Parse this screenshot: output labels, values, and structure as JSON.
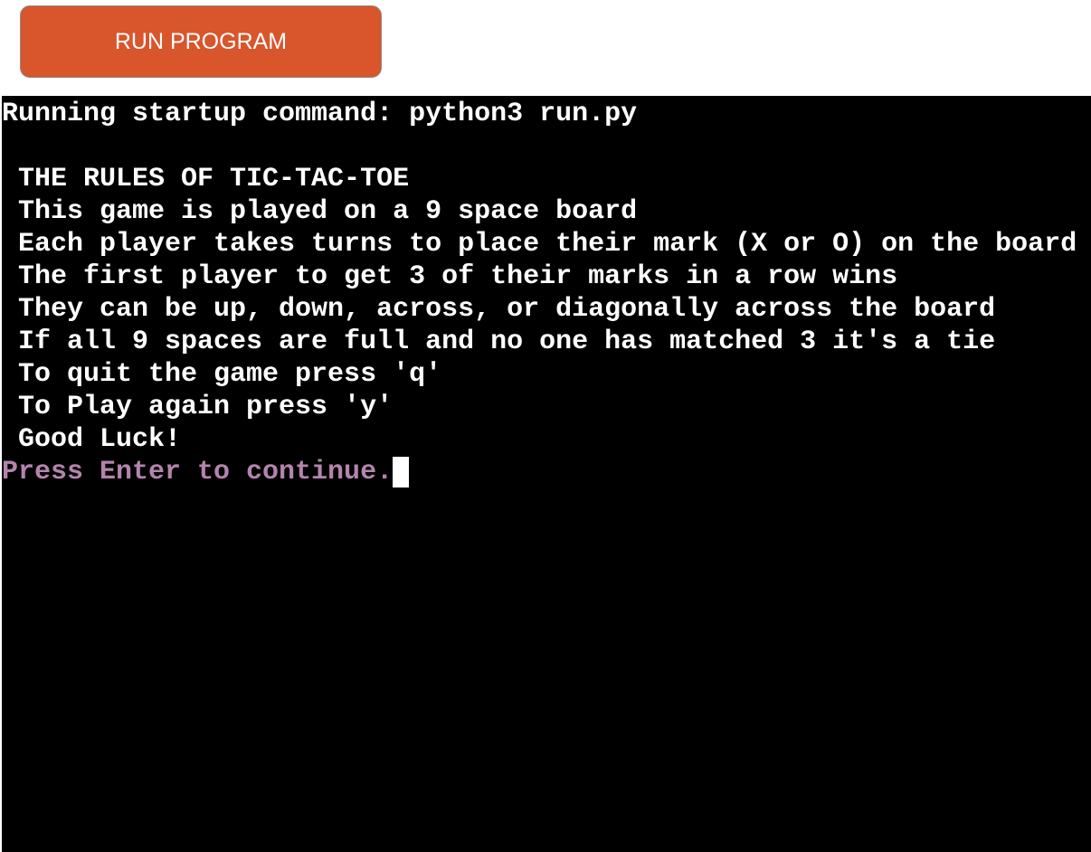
{
  "toolbar": {
    "run_label": "RUN PROGRAM"
  },
  "terminal": {
    "startup_line": "Running startup command: python3 run.py",
    "rules": [
      " THE RULES OF TIC-TAC-TOE",
      " This game is played on a 9 space board",
      " Each player takes turns to place their mark (X or O) on the board",
      " The first player to get 3 of their marks in a row wins",
      " They can be up, down, across, or diagonally across the board",
      " If all 9 spaces are full and no one has matched 3 it's a tie",
      " To quit the game press 'q'",
      " To Play again press 'y'",
      " Good Luck!"
    ],
    "prompt": "Press Enter to continue."
  },
  "colors": {
    "button_bg": "#d9552b",
    "terminal_bg": "#000000",
    "terminal_text": "#ffffff",
    "prompt_text": "#b384ad"
  }
}
